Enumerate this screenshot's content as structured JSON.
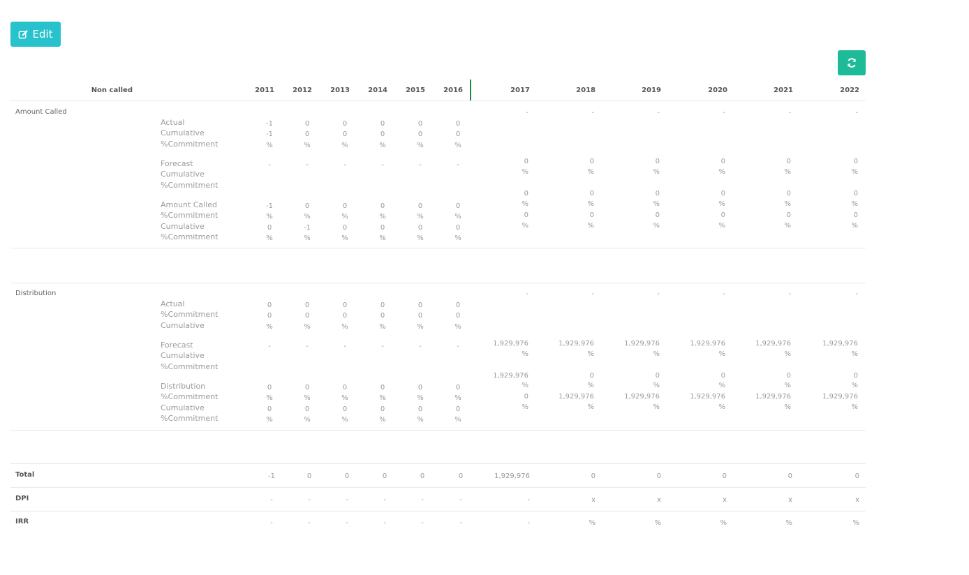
{
  "toolbar": {
    "edit_label": "Edit",
    "edit_icon": "edit-icon",
    "refresh_icon": "refresh-icon",
    "accent_edit": "#27c2cc",
    "accent_refresh": "#1dbb97",
    "divider_color": "#1e8a3b"
  },
  "table": {
    "first_header": "Non called",
    "years": [
      "2011",
      "2012",
      "2013",
      "2014",
      "2015",
      "2016",
      "2017",
      "2018",
      "2019",
      "2020",
      "2021",
      "2022"
    ],
    "sections": [
      {
        "title": "Amount Called",
        "groups": [
          {
            "labels": [
              "Actual",
              "Cumulative",
              "%Commitment"
            ],
            "past": [
              [
                "-1",
                "0",
                "0",
                "0",
                "0",
                "0"
              ],
              [
                "-1",
                "0",
                "0",
                "0",
                "0",
                "0"
              ],
              [
                "%",
                "%",
                "%",
                "%",
                "%",
                "%"
              ]
            ],
            "future": [
              [
                "-",
                "-",
                "-",
                "-",
                "-",
                "-"
              ]
            ]
          },
          {
            "labels": [
              "Forecast",
              "Cumulative",
              "%Commitment"
            ],
            "past": [
              [
                "-",
                "-",
                "-",
                "-",
                "-",
                "-"
              ]
            ],
            "future": [
              [
                "0",
                "0",
                "0",
                "0",
                "0",
                "0"
              ],
              [
                "%",
                "%",
                "%",
                "%",
                "%",
                "%"
              ],
              [],
              [
                "0",
                "0",
                "0",
                "0",
                "0",
                "0"
              ]
            ]
          },
          {
            "labels": [
              "Amount Called",
              "%Commitment",
              "Cumulative",
              "%Commitment"
            ],
            "past": [
              [
                "-1",
                "0",
                "0",
                "0",
                "0",
                "0"
              ],
              [
                "%",
                "%",
                "%",
                "%",
                "%",
                "%"
              ],
              [
                "0",
                "-1",
                "0",
                "0",
                "0",
                "0"
              ],
              [
                "%",
                "%",
                "%",
                "%",
                "%",
                "%"
              ]
            ],
            "future": [
              [
                "%",
                "%",
                "%",
                "%",
                "%",
                "%"
              ],
              [
                "0",
                "0",
                "0",
                "0",
                "0",
                "0"
              ],
              [
                "%",
                "%",
                "%",
                "%",
                "%",
                "%"
              ]
            ]
          }
        ]
      },
      {
        "title": "Distribution",
        "groups": [
          {
            "labels": [
              "Actual",
              "%Commitment",
              "Cumulative"
            ],
            "past": [
              [
                "0",
                "0",
                "0",
                "0",
                "0",
                "0"
              ],
              [
                "0",
                "0",
                "0",
                "0",
                "0",
                "0"
              ],
              [
                "%",
                "%",
                "%",
                "%",
                "%",
                "%"
              ]
            ],
            "future": [
              [
                "-",
                "-",
                "-",
                "-",
                "-",
                "-"
              ]
            ]
          },
          {
            "labels": [
              "Forecast",
              "Cumulative",
              "%Commitment"
            ],
            "past": [
              [
                "-",
                "-",
                "-",
                "-",
                "-",
                "-"
              ]
            ],
            "future": [
              [
                "1,929,976",
                "1,929,976",
                "1,929,976",
                "1,929,976",
                "1,929,976",
                "1,929,976"
              ],
              [
                "%",
                "%",
                "%",
                "%",
                "%",
                "%"
              ],
              [],
              [
                "1,929,976",
                "0",
                "0",
                "0",
                "0",
                "0"
              ]
            ]
          },
          {
            "labels": [
              "Distribution",
              "%Commitment",
              "Cumulative",
              "%Commitment"
            ],
            "past": [
              [
                "0",
                "0",
                "0",
                "0",
                "0",
                "0"
              ],
              [
                "%",
                "%",
                "%",
                "%",
                "%",
                "%"
              ],
              [
                "0",
                "0",
                "0",
                "0",
                "0",
                "0"
              ],
              [
                "%",
                "%",
                "%",
                "%",
                "%",
                "%"
              ]
            ],
            "future": [
              [
                "%",
                "%",
                "%",
                "%",
                "%",
                "%"
              ],
              [
                "0",
                "1,929,976",
                "1,929,976",
                "1,929,976",
                "1,929,976",
                "1,929,976"
              ],
              [
                "%",
                "%",
                "%",
                "%",
                "%",
                "%"
              ]
            ]
          }
        ]
      }
    ],
    "totals": [
      {
        "label": "Total",
        "values": [
          "-1",
          "0",
          "0",
          "0",
          "0",
          "0",
          "1,929,976",
          "0",
          "0",
          "0",
          "0",
          "0"
        ]
      },
      {
        "label": "DPI",
        "values": [
          "-",
          "-",
          "-",
          "-",
          "-",
          "-",
          "-",
          "x",
          "x",
          "x",
          "x",
          "x"
        ]
      },
      {
        "label": "IRR",
        "values": [
          "-",
          "-",
          "-",
          "-",
          "-",
          "-",
          "-",
          "%",
          "%",
          "%",
          "%",
          "%"
        ]
      }
    ]
  }
}
